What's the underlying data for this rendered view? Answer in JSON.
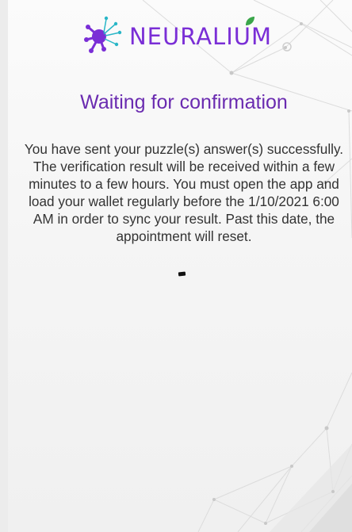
{
  "brand": {
    "name": "NEURALIUM",
    "logo_icon": "neuralium-logo-icon",
    "color": "#7a2ed6"
  },
  "page": {
    "title": "Waiting for confirmation",
    "message": "You have sent your puzzle(s) answer(s) successfully. The verification result will be received within a few minutes to a few hours. You must open the app and load your wallet regularly before the 1/10/2021 6:00 AM in order to sync your result. Past this date, the appointment will reset."
  },
  "status": {
    "indicator": "loading-indicator"
  },
  "colors": {
    "title": "#6a2bb0",
    "text": "#333333",
    "background": "#f5f5f5"
  }
}
